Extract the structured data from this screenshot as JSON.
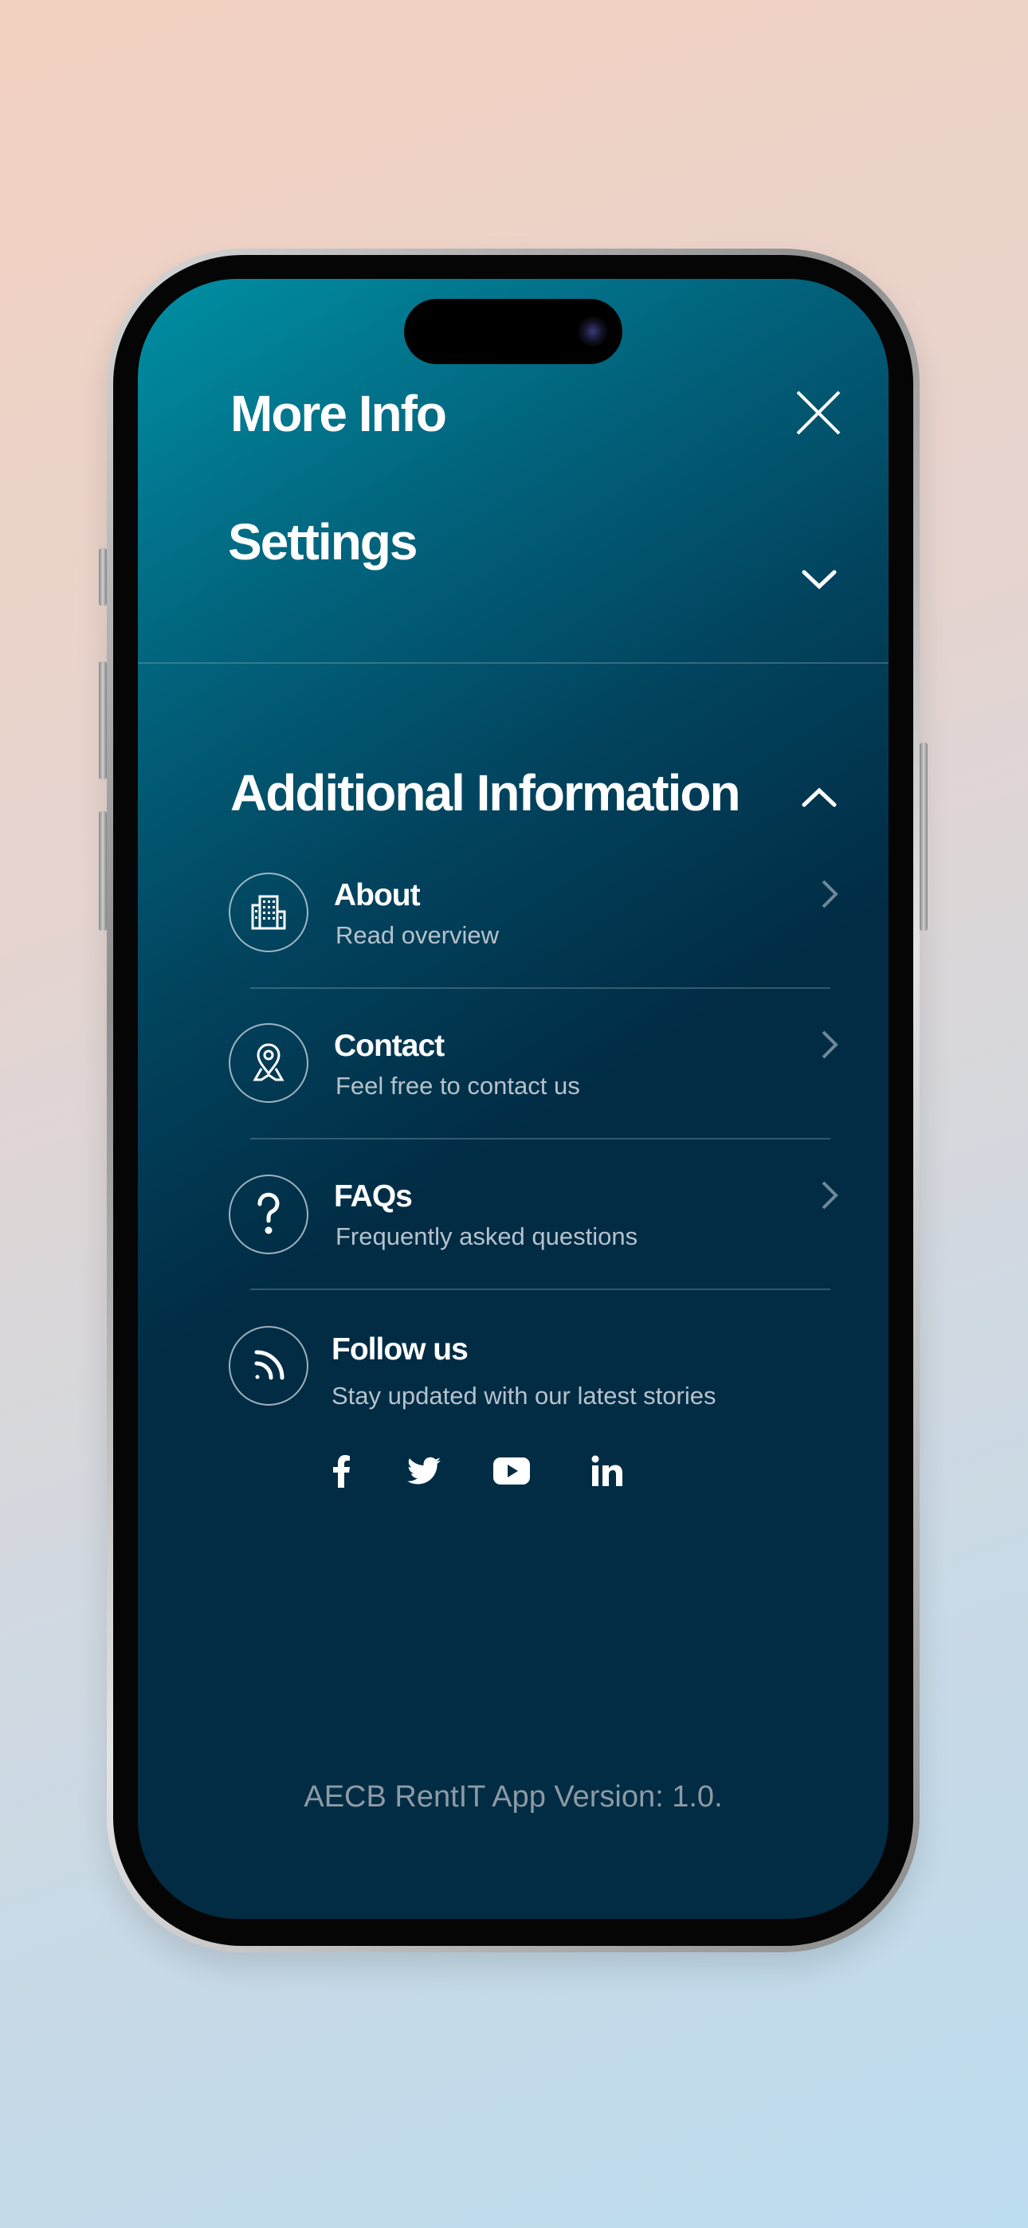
{
  "header": {
    "title": "More Info",
    "close_icon": "close-icon"
  },
  "settings": {
    "label": "Settings",
    "state": "collapsed",
    "icon": "chevron-down-icon"
  },
  "additional": {
    "label": "Additional Information",
    "state": "expanded",
    "icon": "chevron-up-icon",
    "items": [
      {
        "title": "About",
        "subtitle": "Read overview",
        "icon": "building-icon"
      },
      {
        "title": "Contact",
        "subtitle": "Feel free to contact us",
        "icon": "map-pin-icon"
      },
      {
        "title": "FAQs",
        "subtitle": "Frequently asked questions",
        "icon": "question-icon"
      }
    ],
    "follow": {
      "title": "Follow us",
      "subtitle": "Stay updated with our latest stories",
      "icon": "rss-icon",
      "socials": [
        "facebook-icon",
        "twitter-icon",
        "youtube-icon",
        "linkedin-icon"
      ]
    }
  },
  "footer": {
    "version": "AECB RentIT App Version: 1.0."
  },
  "colors": {
    "screen_top": "#0090a4",
    "screen_bottom": "#012c44",
    "subtitle": "#b5c2cb",
    "version": "#8d9aa4"
  }
}
